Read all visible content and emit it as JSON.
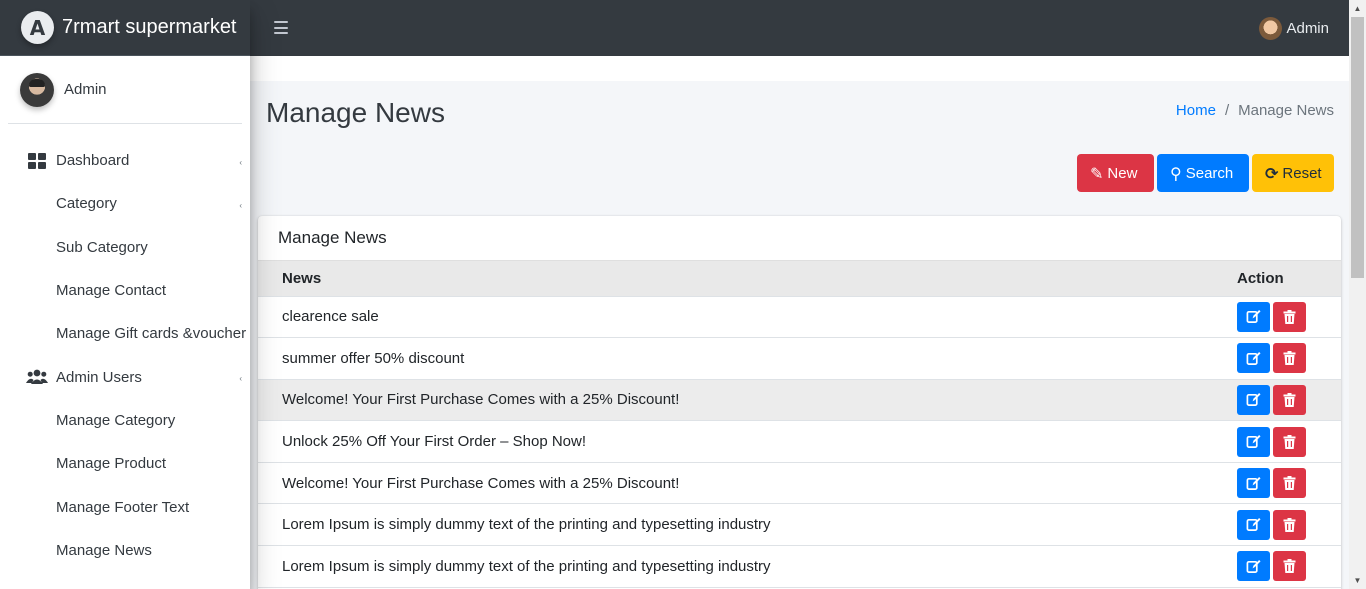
{
  "brand": {
    "logo_letter": "A",
    "name": "7rmart supermarket"
  },
  "sidebar": {
    "user_name": "Admin",
    "items": [
      {
        "label": "Dashboard",
        "level": "top",
        "icon": "th-large-icon",
        "caret": true
      },
      {
        "label": "Category",
        "level": "sub",
        "caret": true
      },
      {
        "label": "Sub Category",
        "level": "sub"
      },
      {
        "label": "Manage Contact",
        "level": "sub"
      },
      {
        "label": "Manage Gift cards &voucher",
        "level": "sub"
      },
      {
        "label": "Admin Users",
        "level": "top",
        "icon": "users-icon",
        "caret": true
      },
      {
        "label": "Manage Category",
        "level": "sub"
      },
      {
        "label": "Manage Product",
        "level": "sub"
      },
      {
        "label": "Manage Footer Text",
        "level": "sub"
      },
      {
        "label": "Manage News",
        "level": "sub"
      }
    ]
  },
  "topbar": {
    "user_name": "Admin"
  },
  "page": {
    "title": "Manage News",
    "breadcrumb": {
      "home": "Home",
      "separator": "/",
      "current": "Manage News"
    }
  },
  "actions": {
    "new_label": "New",
    "search_label": "Search",
    "reset_label": "Reset"
  },
  "card": {
    "title": "Manage News",
    "columns": [
      "News",
      "Action"
    ],
    "rows": [
      "clearence sale",
      "summer offer 50% discount",
      "Welcome! Your First Purchase Comes with a 25% Discount!",
      "Unlock 25% Off Your First Order – Shop Now!",
      "Welcome! Your First Purchase Comes with a 25% Discount!",
      "Lorem Ipsum is simply dummy text of the printing and typesetting industry",
      "Lorem Ipsum is simply dummy text of the printing and typesetting industry"
    ],
    "highlighted_row": 2
  },
  "colors": {
    "topbar": "#343a40",
    "danger": "#dc3545",
    "primary": "#007bff",
    "warning": "#ffc107"
  }
}
